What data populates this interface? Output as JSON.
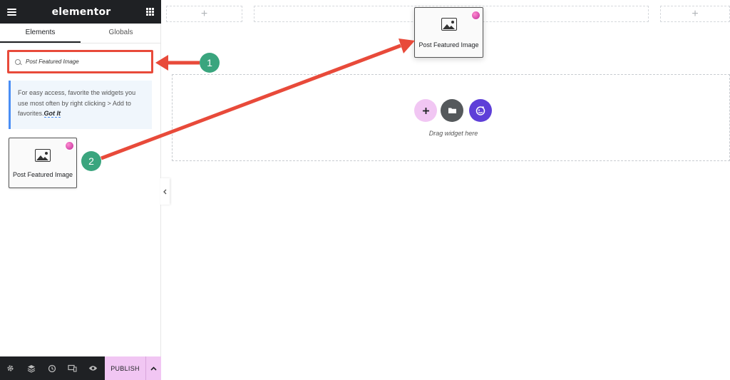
{
  "app": {
    "logo": "elementor"
  },
  "tabs": [
    {
      "label": "Elements"
    },
    {
      "label": "Globals"
    }
  ],
  "search": {
    "query": "Post Featured Image"
  },
  "notice": {
    "text": "For easy access, favorite the widgets you use most often by right clicking > Add to favorites.",
    "link": "Got It"
  },
  "widget": {
    "label": "Post Featured Image",
    "icon": "image-icon",
    "badge": "pro-badge"
  },
  "floating_widget": {
    "label": "Post Featured Image"
  },
  "canvas": {
    "drag_hint": "Drag widget here",
    "add_label": "+",
    "column_add": "+"
  },
  "bottom_bar": {
    "icons": [
      "settings-icon",
      "layers-icon",
      "history-icon",
      "responsive-icon",
      "preview-icon"
    ],
    "publish_label": "PUBLISH",
    "publish_arrow": "^"
  },
  "steps": [
    {
      "number": "1"
    },
    {
      "number": "2"
    }
  ],
  "colors": {
    "accent_red": "#e84a3a",
    "step_green": "#3aa57e",
    "publish_pink": "#f1c6f3",
    "add_button": "#f1c6f3",
    "folder_button": "#55595c",
    "ai_button": "#5e3fd8"
  }
}
